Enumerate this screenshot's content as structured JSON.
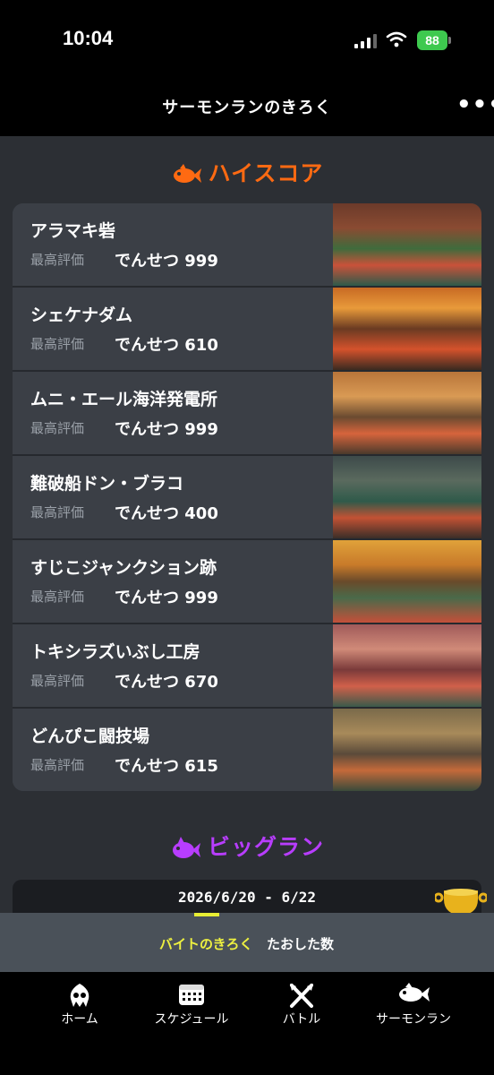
{
  "status_bar": {
    "time": "10:04",
    "battery": "88"
  },
  "header": {
    "title": "サーモンランのきろく",
    "more": "•••"
  },
  "high_score": {
    "title": "ハイスコア",
    "stages": [
      {
        "name": "アラマキ砦",
        "label": "最高評価",
        "rank": "でんせつ 999"
      },
      {
        "name": "シェケナダム",
        "label": "最高評価",
        "rank": "でんせつ 610"
      },
      {
        "name": "ムニ・エール海洋発電所",
        "label": "最高評価",
        "rank": "でんせつ 999"
      },
      {
        "name": "難破船ドン・ブラコ",
        "label": "最高評価",
        "rank": "でんせつ 400"
      },
      {
        "name": "すじこジャンクション跡",
        "label": "最高評価",
        "rank": "でんせつ 999"
      },
      {
        "name": "トキシラズいぶし工房",
        "label": "最高評価",
        "rank": "でんせつ 670"
      },
      {
        "name": "どんぴこ闘技場",
        "label": "最高評価",
        "rank": "でんせつ 615"
      }
    ]
  },
  "big_run": {
    "title": "ビッグラン",
    "date": "2026/6/20 - 6/22"
  },
  "tabs": {
    "active": "バイトのきろく",
    "other": "たおした数"
  },
  "bottom_nav": [
    {
      "label": "ホーム",
      "icon": "squid-icon"
    },
    {
      "label": "スケジュール",
      "icon": "calendar-icon"
    },
    {
      "label": "バトル",
      "icon": "crossed-weapons-icon"
    },
    {
      "label": "サーモンラン",
      "icon": "salmon-icon"
    }
  ]
}
